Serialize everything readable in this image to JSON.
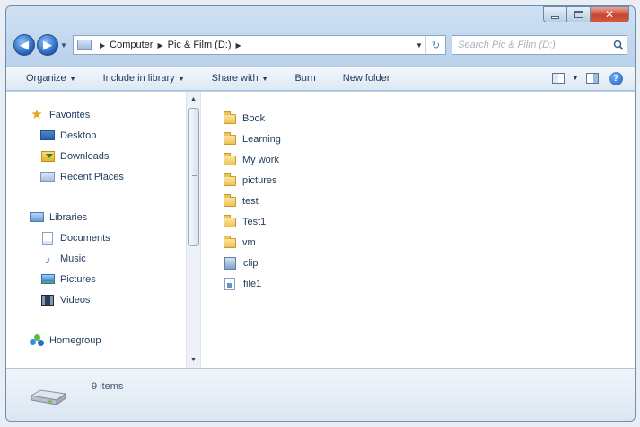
{
  "address_bar": {
    "crumbs": [
      "Computer",
      "Pic & Film (D:)"
    ]
  },
  "search": {
    "placeholder": "Search Pic & Film (D:)"
  },
  "toolbar": {
    "organize": "Organize",
    "include_in_library": "Include in library",
    "share_with": "Share with",
    "burn": "Burn",
    "new_folder": "New folder"
  },
  "nav_pane": {
    "favorites": {
      "label": "Favorites",
      "items": [
        "Desktop",
        "Downloads",
        "Recent Places"
      ]
    },
    "libraries": {
      "label": "Libraries",
      "items": [
        "Documents",
        "Music",
        "Pictures",
        "Videos"
      ]
    },
    "homegroup": "Homegroup"
  },
  "files": [
    {
      "name": "Book",
      "type": "folder"
    },
    {
      "name": "Learning",
      "type": "folder"
    },
    {
      "name": "My work",
      "type": "folder"
    },
    {
      "name": "pictures",
      "type": "folder"
    },
    {
      "name": "test",
      "type": "folder"
    },
    {
      "name": "Test1",
      "type": "folder"
    },
    {
      "name": "vm",
      "type": "folder"
    },
    {
      "name": "clip",
      "type": "video-file"
    },
    {
      "name": "file1",
      "type": "file"
    }
  ],
  "details": {
    "item_count": "9 items"
  },
  "colors": {
    "window_frame": "#bcd3ec",
    "toolbar_text": "#1e3a5c",
    "folder": "#edc25b",
    "close_button": "#c6452d"
  }
}
